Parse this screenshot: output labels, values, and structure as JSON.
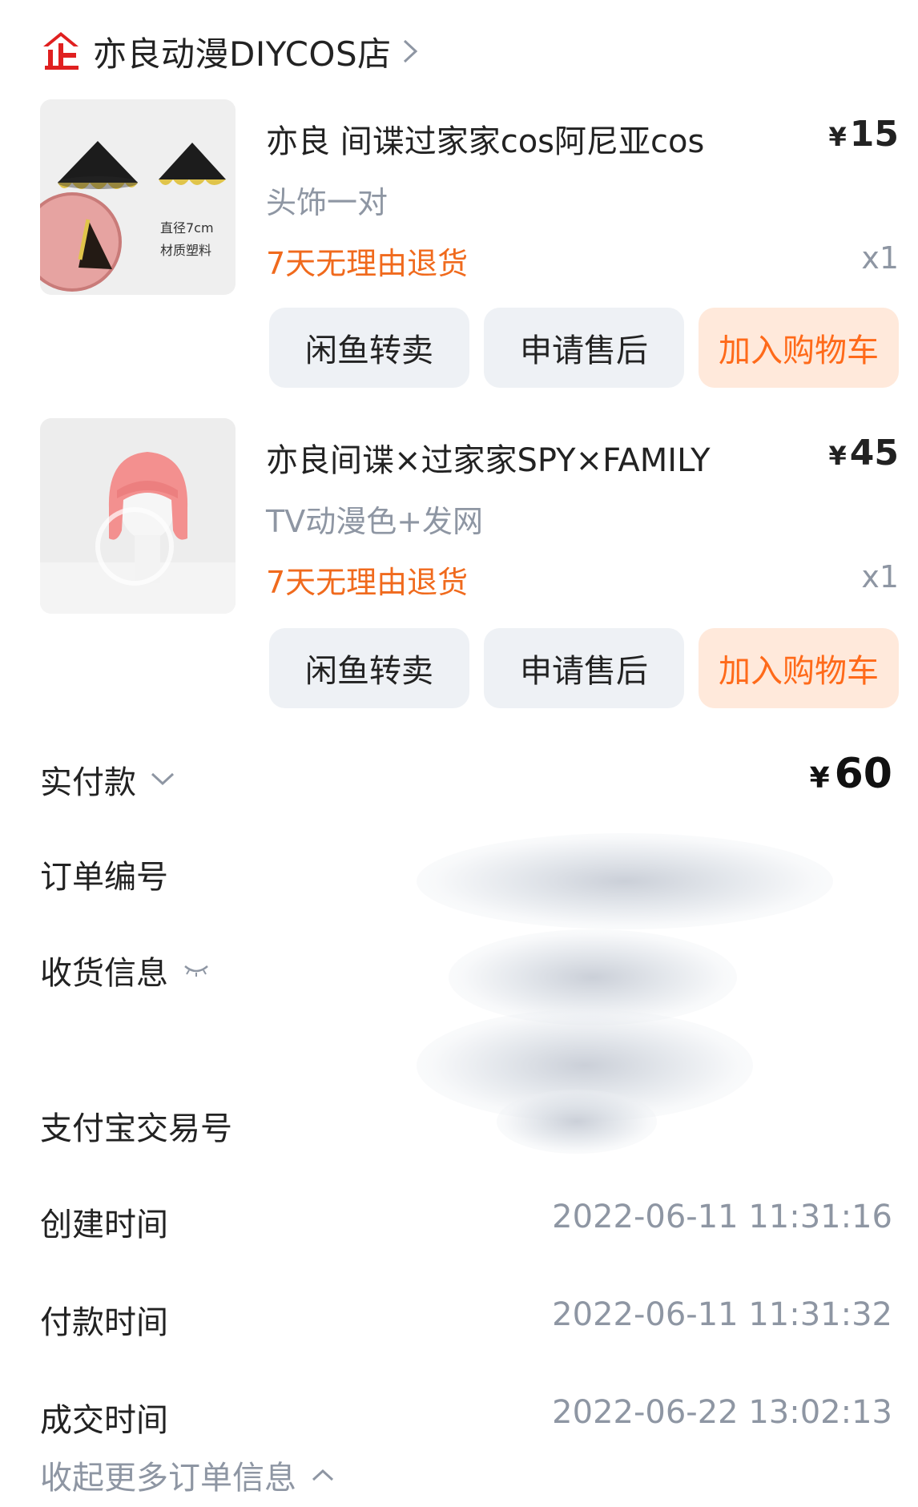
{
  "shop": {
    "name": "亦良动漫DIYCOS店"
  },
  "products": [
    {
      "title": "亦良 间谍过家家cos阿尼亚cos",
      "price_symbol": "¥",
      "price": "15",
      "sku": "头饰一对",
      "return_policy": "7天无理由退货",
      "quantity": "x1",
      "thumb_caption_1": "直径7cm",
      "thumb_caption_2": "材质塑料",
      "buttons": {
        "resell": "闲鱼转卖",
        "after_sale": "申请售后",
        "add_cart": "加入购物车"
      }
    },
    {
      "title": "亦良间谍×过家家SPY×FAMILY",
      "price_symbol": "¥",
      "price": "45",
      "sku": "TV动漫色+发网",
      "return_policy": "7天无理由退货",
      "quantity": "x1",
      "buttons": {
        "resell": "闲鱼转卖",
        "after_sale": "申请售后",
        "add_cart": "加入购物车"
      }
    }
  ],
  "order": {
    "total_label": "实付款",
    "total_symbol": "¥",
    "total_value": "60",
    "order_no_label": "订单编号",
    "shipping_label": "收货信息",
    "alipay_label": "支付宝交易号",
    "created_label": "创建时间",
    "created_value": "2022-06-11 11:31:16",
    "paid_label": "付款时间",
    "paid_value": "2022-06-11 11:31:32",
    "deal_label": "成交时间",
    "deal_value": "2022-06-22 13:02:13",
    "collapse_label": "收起更多订单信息"
  },
  "colors": {
    "accent": "#ff6a1a",
    "return_policy": "#f06a1d",
    "muted_text": "#8e96a3",
    "button_bg": "#eef1f5",
    "cart_button_bg": "#ffe9db",
    "shop_logo": "#e02020"
  },
  "icons": {
    "shop_logo": "enterprise-shop-icon",
    "shop_chevron": "chevron-right-icon",
    "total_toggle": "chevron-down-icon",
    "shipping_toggle": "eye-closed-icon",
    "collapse_toggle": "chevron-up-icon"
  }
}
